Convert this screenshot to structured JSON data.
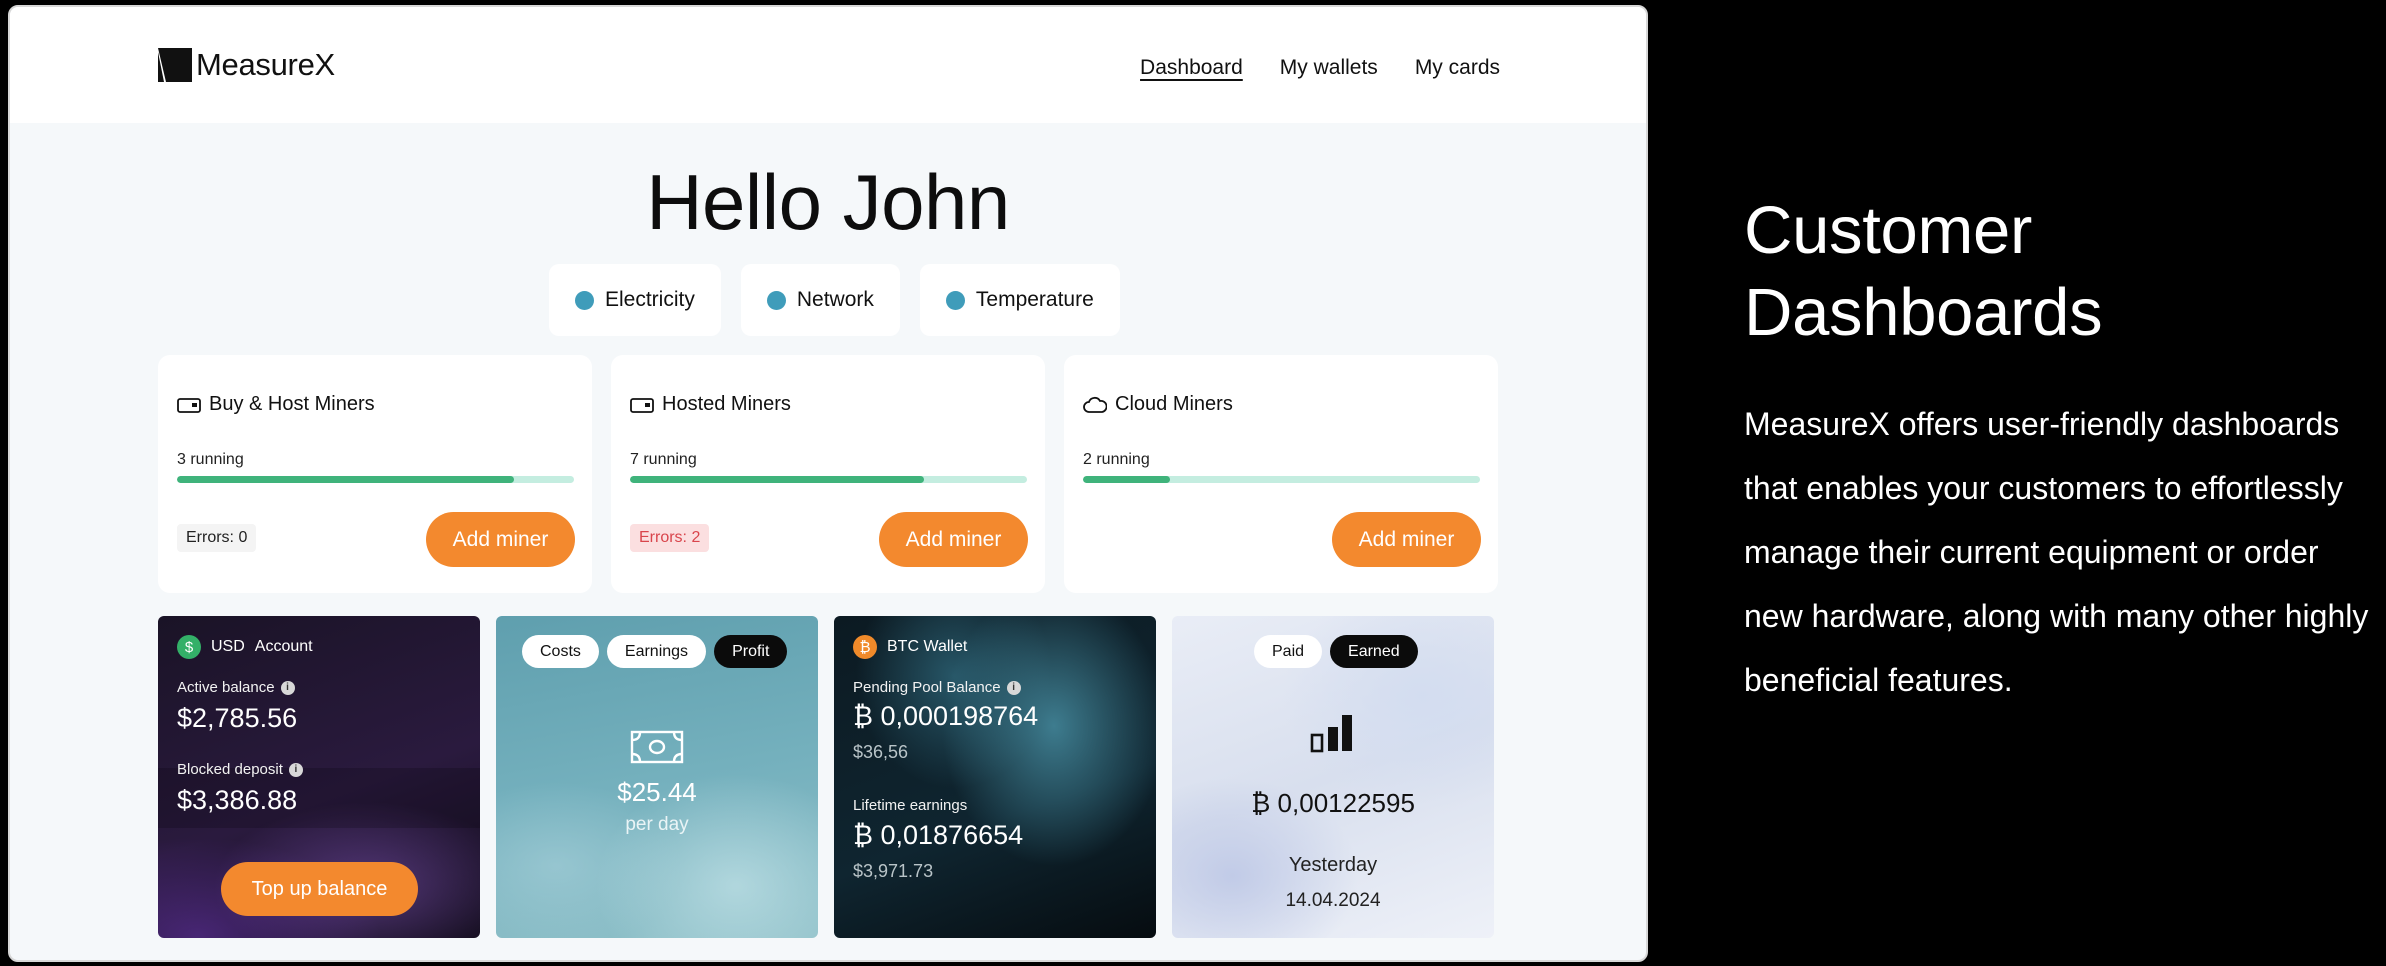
{
  "brand": {
    "name": "MeasureX"
  },
  "nav": [
    {
      "label": "Dashboard",
      "active": true
    },
    {
      "label": "My wallets",
      "active": false
    },
    {
      "label": "My cards",
      "active": false
    }
  ],
  "greeting": "Hello John",
  "status_indicators": [
    {
      "label": "Electricity",
      "color": "#3f9cba"
    },
    {
      "label": "Network",
      "color": "#3f9cba"
    },
    {
      "label": "Temperature",
      "color": "#3f9cba"
    }
  ],
  "miners": [
    {
      "title": "Buy & Host Miners",
      "icon": "card-icon",
      "running": "3 running",
      "progress_pct": 85,
      "errors": "Errors: 0",
      "button": "Add miner"
    },
    {
      "title": "Hosted Miners",
      "icon": "card-icon",
      "running": "7 running",
      "progress_pct": 74,
      "errors": "Errors: 2",
      "button": "Add miner"
    },
    {
      "title": "Cloud Miners",
      "icon": "cloud-icon",
      "running": "2 running",
      "progress_pct": 22,
      "errors": "",
      "button": "Add miner"
    }
  ],
  "usd_account": {
    "currency": "USD",
    "title": "Account",
    "active_label": "Active balance",
    "active_value": "$2,785.56",
    "blocked_label": "Blocked deposit",
    "blocked_value": "$3,386.88",
    "button": "Top up balance"
  },
  "profit_tile": {
    "tabs": [
      {
        "label": "Costs",
        "active": false
      },
      {
        "label": "Earnings",
        "active": false
      },
      {
        "label": "Profit",
        "active": true
      }
    ],
    "amount": "$25.44",
    "period": "per day"
  },
  "btc_wallet": {
    "title": "BTC Wallet",
    "pending_label": "Pending Pool Balance",
    "pending_btc": "₿ 0,000198764",
    "pending_usd": "$36,56",
    "lifetime_label": "Lifetime earnings",
    "lifetime_btc": "₿ 0,01876654",
    "lifetime_usd": "$3,971.73"
  },
  "earned_tile": {
    "tabs": [
      {
        "label": "Paid",
        "active": false
      },
      {
        "label": "Earned",
        "active": true
      }
    ],
    "amount": "₿ 0,00122595",
    "when": "Yesterday",
    "date": "14.04.2024"
  },
  "promo": {
    "title_line1": "Customer",
    "title_line2": "Dashboards",
    "body": "MeasureX offers user-friendly dashboards that enables your customers to effortlessly manage their current equipment or order new hardware, along with many other highly beneficial features."
  },
  "colors": {
    "accent": "#f3892e",
    "success": "#3fb37b",
    "status_dot": "#3f9cba",
    "error": "#d9454c"
  }
}
